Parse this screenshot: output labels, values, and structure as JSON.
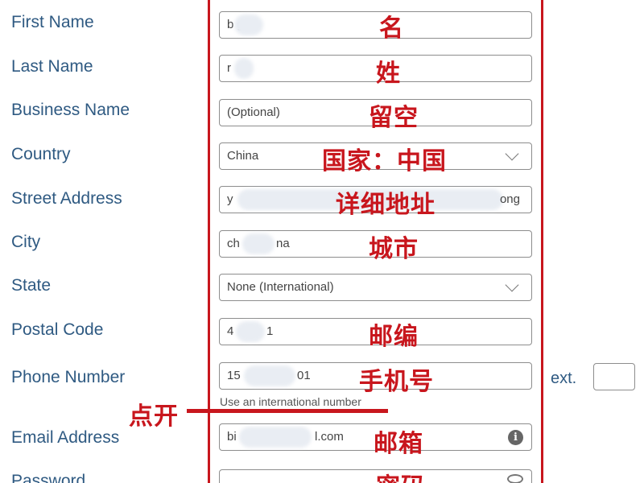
{
  "form": {
    "first_name": {
      "label": "First Name",
      "value": "b      g"
    },
    "last_name": {
      "label": "Last Name",
      "value": "r"
    },
    "business_name": {
      "label": "Business Name",
      "placeholder": "(Optional)"
    },
    "country": {
      "label": "Country",
      "value": "China"
    },
    "street_address": {
      "label": "Street Address",
      "value_start": "y",
      "value_end": "ong"
    },
    "city": {
      "label": "City",
      "value_start": "ch",
      "value_end": "na"
    },
    "state": {
      "label": "State",
      "value": "None (International)"
    },
    "postal_code": {
      "label": "Postal Code",
      "value_start": "4",
      "value_end": "1"
    },
    "phone_number": {
      "label": "Phone Number",
      "value_start": "15",
      "value_end": "01",
      "hint": "Use an international number",
      "ext_label": "ext."
    },
    "email_address": {
      "label": "Email Address",
      "value_start": "bi",
      "value_end": "l.com"
    },
    "password": {
      "label": "Password"
    }
  },
  "annotations": {
    "first_name": "名",
    "last_name": "姓",
    "business_name": "留空",
    "country": "国家：中国",
    "street_address": "详细地址",
    "city": "城市",
    "postal_code": "邮编",
    "phone_number": "手机号",
    "email_address": "邮箱",
    "password": "密码",
    "click_open": "点开"
  },
  "icons": {
    "country": "chevron-down-icon",
    "state": "chevron-down-icon",
    "email_address": "info-icon",
    "password": "eye-icon"
  },
  "colors": {
    "label": "#2f5a82",
    "annotation": "#c8161d",
    "field_border": "#8d8d8d"
  }
}
